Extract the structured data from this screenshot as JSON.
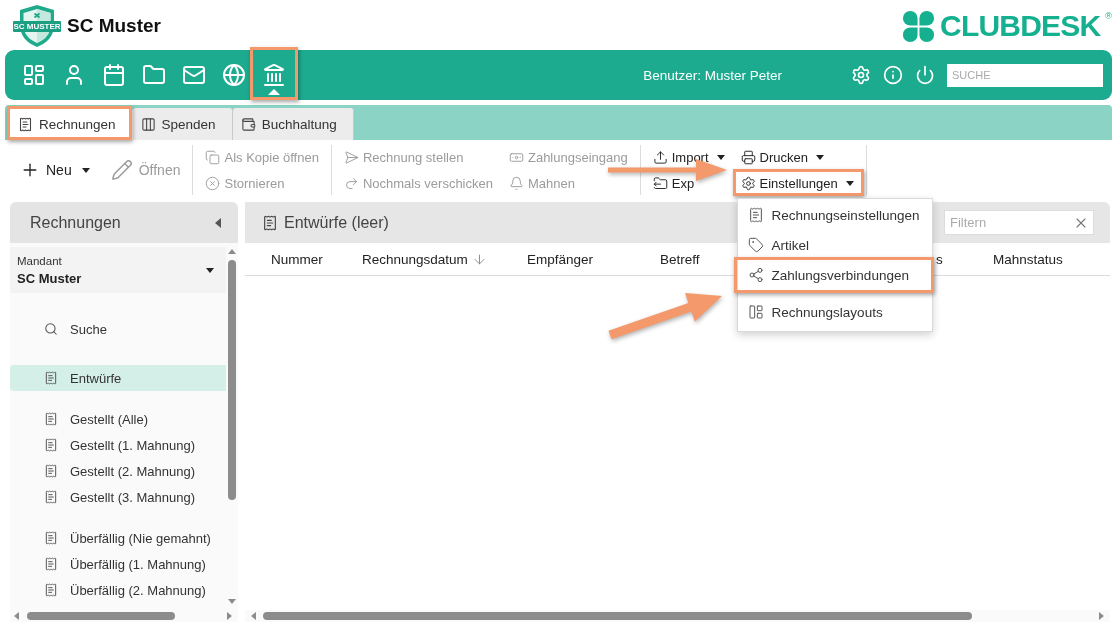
{
  "header": {
    "crest_text": "SC MUSTER",
    "club_name": "SC Muster",
    "brand": {
      "name": "CLUBDESK",
      "mark": "®"
    }
  },
  "navbar": {
    "modules": [
      {
        "kind": "dashboard",
        "selected": false,
        "highlighted": false
      },
      {
        "kind": "contacts",
        "selected": false,
        "highlighted": false
      },
      {
        "kind": "calendar",
        "selected": false,
        "highlighted": false
      },
      {
        "kind": "files",
        "selected": false,
        "highlighted": false
      },
      {
        "kind": "mail",
        "selected": false,
        "highlighted": false
      },
      {
        "kind": "web",
        "selected": false,
        "highlighted": false
      },
      {
        "kind": "finance",
        "selected": true,
        "highlighted": true
      }
    ],
    "user": "Benutzer: Muster Peter",
    "search": {
      "placeholder": "SUCHE"
    }
  },
  "tabs": [
    {
      "kind": "invoice",
      "label": "Rechnungen",
      "selected": true,
      "highlighted": true
    },
    {
      "kind": "donations",
      "label": "Spenden",
      "selected": false,
      "highlighted": false
    },
    {
      "kind": "accounting",
      "label": "Buchhaltung",
      "selected": false,
      "highlighted": false
    }
  ],
  "toolbar": {
    "groups": [
      {
        "kind": "large",
        "columns": [
          [
            {
              "kind": "new",
              "label": "Neu",
              "disabled": false,
              "dropdown": true,
              "highlighted": false
            }
          ],
          [
            {
              "kind": "open",
              "label": "Öffnen",
              "disabled": true,
              "dropdown": false,
              "highlighted": false
            }
          ]
        ]
      },
      {
        "kind": "compact",
        "columns": [
          [
            {
              "kind": "copy",
              "label": "Als Kopie öffnen",
              "disabled": true,
              "dropdown": false,
              "highlighted": false
            },
            {
              "kind": "cancel",
              "label": "Stornieren",
              "disabled": true,
              "dropdown": false,
              "highlighted": false
            }
          ]
        ]
      },
      {
        "kind": "compact",
        "columns": [
          [
            {
              "kind": "send",
              "label": "Rechnung stellen",
              "disabled": true,
              "dropdown": false,
              "highlighted": false
            },
            {
              "kind": "resend",
              "label": "Nochmals verschicken",
              "disabled": true,
              "dropdown": false,
              "highlighted": false
            }
          ],
          [
            {
              "kind": "payment",
              "label": "Zahlungseingang",
              "disabled": true,
              "dropdown": false,
              "highlighted": false
            },
            {
              "kind": "remind",
              "label": "Mahnen",
              "disabled": true,
              "dropdown": false,
              "highlighted": false
            }
          ]
        ]
      },
      {
        "kind": "compact",
        "columns": [
          [
            {
              "kind": "import",
              "label": "Import",
              "disabled": false,
              "dropdown": true,
              "highlighted": false
            },
            {
              "kind": "export",
              "label": "Exp",
              "disabled": false,
              "dropdown": false,
              "highlighted": false
            }
          ],
          [
            {
              "kind": "print",
              "label": "Drucken",
              "disabled": false,
              "dropdown": true,
              "highlighted": false
            },
            {
              "kind": "settings",
              "label": "Einstellungen",
              "disabled": false,
              "dropdown": true,
              "expanded": true,
              "highlighted": true,
              "menu": {
                "items": [
                  {
                    "kind": "invoice",
                    "label": "Rechnungseinstellungen",
                    "highlighted": false,
                    "group_start": false
                  },
                  {
                    "kind": "tag",
                    "label": "Artikel",
                    "highlighted": false,
                    "group_start": false
                  },
                  {
                    "kind": "share",
                    "label": "Zahlungsverbindungen",
                    "highlighted": true,
                    "group_start": false
                  },
                  {
                    "kind": "layout",
                    "label": "Rechnungslayouts",
                    "highlighted": false,
                    "group_start": true
                  }
                ]
              }
            }
          ]
        ]
      }
    ]
  },
  "sidebar": {
    "title": "Rechnungen",
    "mandant": {
      "label": "Mandant",
      "value": "SC Muster"
    },
    "search": {
      "label": "Suche",
      "selected": false
    },
    "groups": [
      [
        {
          "label": "Entwürfe",
          "selected": true
        }
      ],
      [
        {
          "label": "Gestellt (Alle)",
          "selected": false
        },
        {
          "label": "Gestellt (1. Mahnung)",
          "selected": false
        },
        {
          "label": "Gestellt (2. Mahnung)",
          "selected": false
        },
        {
          "label": "Gestellt (3. Mahnung)",
          "selected": false
        }
      ],
      [
        {
          "label": "Überfällig (Nie gemahnt)",
          "selected": false
        },
        {
          "label": "Überfällig (1. Mahnung)",
          "selected": false
        },
        {
          "label": "Überfällig (2. Mahnung)",
          "selected": false
        }
      ]
    ]
  },
  "list": {
    "title": "Entwürfe (leer)",
    "filter": {
      "placeholder": "Filtern"
    },
    "columns": [
      {
        "label": "Nummer",
        "sorted": false
      },
      {
        "label": "Rechnungsdatum",
        "sorted": true
      },
      {
        "label": "Empfänger",
        "sorted": false
      },
      {
        "label": "Betreff",
        "sorted": false
      },
      {
        "label": "s",
        "sorted": false
      },
      {
        "label": "Mahnstatus",
        "sorted": false
      }
    ]
  }
}
